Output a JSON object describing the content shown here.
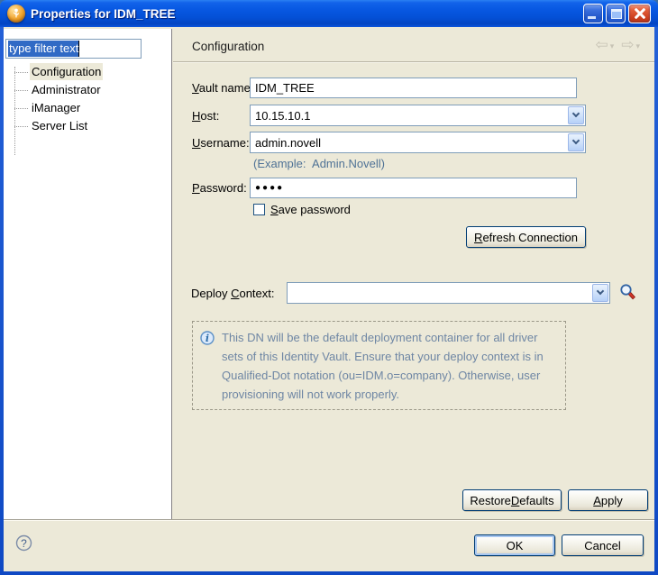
{
  "window": {
    "title": "Properties for IDM_TREE",
    "controls": {
      "minimize": "minimize",
      "maximize": "maximize",
      "close": "close"
    }
  },
  "sidebar": {
    "filter_value": "type filter text",
    "items": [
      {
        "label": "Configuration",
        "selected": true
      },
      {
        "label": "Administrator",
        "selected": false
      },
      {
        "label": "iManager",
        "selected": false
      },
      {
        "label": "Server List",
        "selected": false
      }
    ]
  },
  "header": {
    "title": "Configuration",
    "back_arrow": "⇦",
    "forward_arrow": "⇨",
    "dropdown_arrow": "▾"
  },
  "form": {
    "vault_name_label": "Vault name:",
    "vault_name_value": "IDM_TREE",
    "host_label": "Host:",
    "host_value": "10.15.10.1",
    "username_label": "Username:",
    "username_value": "admin.novell",
    "username_hint": "(Example:  Admin.Novell)",
    "password_label": "Password:",
    "password_value": "●●●●",
    "save_password_label": "Save password",
    "save_password_checked": false,
    "refresh_button_label": "Refresh Connection",
    "deploy_context_label": "Deploy Context:",
    "deploy_context_value": "",
    "note_text": "This DN will be the default deployment container for all driver sets of this Identity Vault. Ensure that your deploy context is in Qualified-Dot notation (ou=IDM.o=company). Otherwise, user provisioning will not work properly."
  },
  "buttons": {
    "restore_defaults": "Restore Defaults",
    "apply": "Apply",
    "ok": "OK",
    "cancel": "Cancel",
    "help": "?"
  },
  "colors": {
    "titlebar_blue": "#0858e2",
    "panel_beige": "#ece9d8",
    "selection_blue": "#316ac5",
    "hint_blue": "#4f7296",
    "note_blue": "#6e86a4",
    "input_border": "#7f9db9"
  }
}
